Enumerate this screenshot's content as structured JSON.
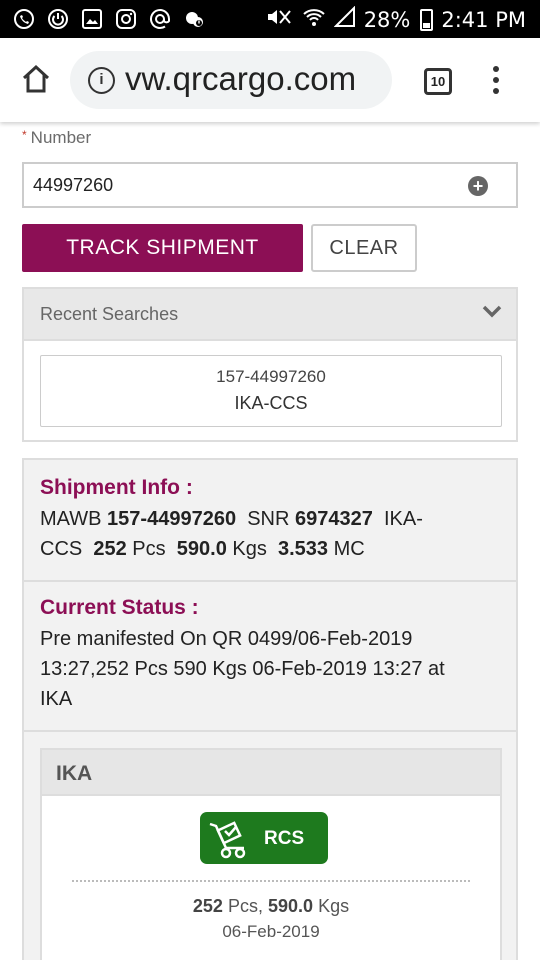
{
  "status_bar": {
    "left_icons": [
      "whatsapp-icon",
      "power-icon",
      "gallery-icon",
      "instagram-icon",
      "at-icon",
      "weather-icon"
    ],
    "battery": "28%",
    "time": "2:41 PM"
  },
  "browser": {
    "url": "vw.qrcargo.com",
    "tab_count": "10"
  },
  "form": {
    "label_required": "*",
    "label": "Number",
    "number_value": "44997260",
    "track_button": "TRACK SHIPMENT",
    "clear_button": "CLEAR"
  },
  "recent": {
    "title": "Recent Searches",
    "items": [
      {
        "awb": "157-44997260",
        "route": "IKA-CCS"
      }
    ]
  },
  "shipment": {
    "title": "Shipment Info :",
    "mawb_label": "MAWB",
    "mawb": "157-44997260",
    "snr_label": "SNR",
    "snr": "6974327",
    "route_part1": "IKA-",
    "route_part2": "CCS",
    "pcs": "252",
    "pcs_unit": "Pcs",
    "kgs": "590.0",
    "kgs_unit": "Kgs",
    "mc": "3.533",
    "mc_unit": "MC"
  },
  "status": {
    "title": "Current Status :",
    "line1": "Pre manifested On QR 0499/06-Feb-2019",
    "line2": "13:27,252 Pcs 590 Kgs 06-Feb-2019 13:27 at",
    "line3": "IKA"
  },
  "station": {
    "name": "IKA",
    "badge": "RCS",
    "pcs": "252",
    "pcs_unit": "Pcs,",
    "kgs": "590.0",
    "kgs_unit": "Kgs",
    "date": "06-Feb-2019"
  },
  "colors": {
    "brand": "#8c0f55",
    "rcs_green": "#1e7a1e"
  }
}
